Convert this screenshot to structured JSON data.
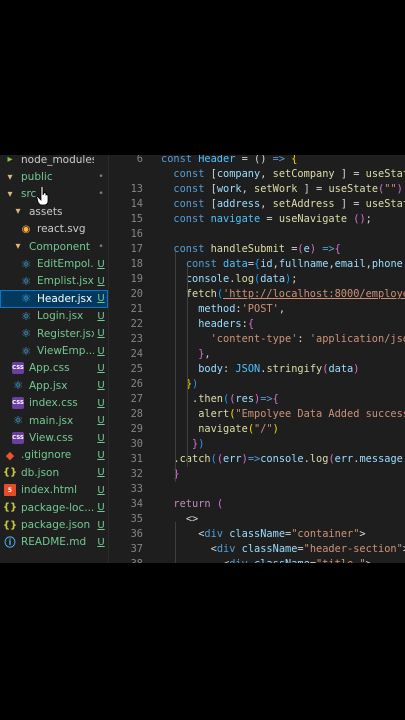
{
  "explorer": {
    "items": [
      {
        "label": "node_modules",
        "icon": "node-folder-icon",
        "status": "",
        "indent": 0
      },
      {
        "label": "public",
        "icon": "folder-icon",
        "status": "•",
        "indent": 0,
        "green": true
      },
      {
        "label": "src",
        "icon": "folder-icon",
        "status": "•",
        "indent": 0,
        "green": true
      },
      {
        "label": "assets",
        "icon": "folder-icon",
        "status": "",
        "indent": 1
      },
      {
        "label": "react.svg",
        "icon": "svg-icon",
        "status": "",
        "indent": 2
      },
      {
        "label": "Component",
        "icon": "folder-icon",
        "status": "•",
        "indent": 1,
        "green": true
      },
      {
        "label": "EditEmpol...",
        "icon": "react-icon",
        "status": "U",
        "indent": 2,
        "green": true
      },
      {
        "label": "Emplist.jsx",
        "icon": "react-icon",
        "status": "U",
        "indent": 2,
        "green": true
      },
      {
        "label": "Header.jsx",
        "icon": "react-icon",
        "status": "U",
        "indent": 2,
        "green": true,
        "selected": true
      },
      {
        "label": "Login.jsx",
        "icon": "react-icon",
        "status": "U",
        "indent": 2,
        "green": true
      },
      {
        "label": "Register.jsx",
        "icon": "react-icon",
        "status": "U",
        "indent": 2,
        "green": true
      },
      {
        "label": "ViewEmp...",
        "icon": "react-icon",
        "status": "U",
        "indent": 2,
        "green": true
      },
      {
        "label": "App.css",
        "icon": "css-icon",
        "status": "U",
        "indent": 1,
        "green": true
      },
      {
        "label": "App.jsx",
        "icon": "react-icon",
        "status": "U",
        "indent": 1,
        "green": true
      },
      {
        "label": "index.css",
        "icon": "css-icon",
        "status": "U",
        "indent": 1,
        "green": true
      },
      {
        "label": "main.jsx",
        "icon": "react-icon",
        "status": "U",
        "indent": 1,
        "green": true
      },
      {
        "label": "View.css",
        "icon": "css-icon",
        "status": "U",
        "indent": 1,
        "green": true
      },
      {
        "label": ".gitignore",
        "icon": "git-icon",
        "status": "U",
        "indent": 0,
        "green": true
      },
      {
        "label": "db.json",
        "icon": "json-icon",
        "status": "U",
        "indent": 0,
        "green": true
      },
      {
        "label": "index.html",
        "icon": "html-icon",
        "status": "U",
        "indent": 0,
        "green": true
      },
      {
        "label": "package-loc...",
        "icon": "json-icon",
        "status": "U",
        "indent": 0,
        "green": true
      },
      {
        "label": "package.json",
        "icon": "json-icon",
        "status": "U",
        "indent": 0,
        "green": true
      },
      {
        "label": "README.md",
        "icon": "info-icon",
        "status": "U",
        "indent": 0,
        "green": true
      }
    ]
  },
  "editor": {
    "lines": [
      {
        "num": "6",
        "tokens": [
          [
            "k",
            "const "
          ],
          [
            "c",
            "Header"
          ],
          [
            "p",
            " = () "
          ],
          [
            "k",
            "=>"
          ],
          [
            "p",
            " "
          ],
          [
            "b1",
            "{"
          ]
        ]
      },
      {
        "num": "",
        "tokens": [
          [
            "p",
            "  "
          ],
          [
            "k",
            "const "
          ],
          [
            "p",
            "["
          ],
          [
            "v",
            "company"
          ],
          [
            "p",
            ", "
          ],
          [
            "f",
            "setCompany"
          ],
          [
            "p",
            " ] = "
          ],
          [
            "f",
            "useState"
          ]
        ]
      },
      {
        "num": "13",
        "tokens": [
          [
            "p",
            "  "
          ],
          [
            "k",
            "const "
          ],
          [
            "p",
            "["
          ],
          [
            "v",
            "work"
          ],
          [
            "p",
            ", "
          ],
          [
            "f",
            "setWork"
          ],
          [
            "p",
            " ] = "
          ],
          [
            "f",
            "useState"
          ],
          [
            "b2",
            "("
          ],
          [
            "s",
            "\"\""
          ],
          [
            "b2",
            ")"
          ]
        ]
      },
      {
        "num": "14",
        "tokens": [
          [
            "p",
            "  "
          ],
          [
            "k",
            "const "
          ],
          [
            "p",
            "["
          ],
          [
            "v",
            "address"
          ],
          [
            "p",
            ", "
          ],
          [
            "f",
            "setAddress"
          ],
          [
            "p",
            " ] = "
          ],
          [
            "f",
            "useState"
          ],
          [
            "b2",
            "("
          ]
        ]
      },
      {
        "num": "15",
        "tokens": [
          [
            "p",
            "  "
          ],
          [
            "k",
            "const "
          ],
          [
            "c",
            "navigate"
          ],
          [
            "p",
            " = "
          ],
          [
            "f",
            "useNavigate"
          ],
          [
            "p",
            " "
          ],
          [
            "b2",
            "("
          ],
          [
            "b2",
            ")"
          ],
          [
            "p",
            ";"
          ]
        ]
      },
      {
        "num": "16",
        "tokens": []
      },
      {
        "num": "17",
        "tokens": [
          [
            "p",
            "  "
          ],
          [
            "k",
            "const "
          ],
          [
            "f",
            "handleSubmit"
          ],
          [
            "p",
            " ="
          ],
          [
            "b2",
            "("
          ],
          [
            "v",
            "e"
          ],
          [
            "b2",
            ")"
          ],
          [
            "p",
            " "
          ],
          [
            "k",
            "=>"
          ],
          [
            "b2",
            "{"
          ]
        ]
      },
      {
        "num": "18",
        "tokens": [
          [
            "p",
            "    "
          ],
          [
            "k",
            "const "
          ],
          [
            "c",
            "data"
          ],
          [
            "p",
            "="
          ],
          [
            "b3",
            "{"
          ],
          [
            "v",
            "id"
          ],
          [
            "p",
            ","
          ],
          [
            "v",
            "fullname"
          ],
          [
            "p",
            ","
          ],
          [
            "v",
            "email"
          ],
          [
            "p",
            ","
          ],
          [
            "v",
            "phone"
          ],
          [
            "p",
            ","
          ]
        ]
      },
      {
        "num": "19",
        "tokens": [
          [
            "p",
            "    "
          ],
          [
            "v",
            "console"
          ],
          [
            "p",
            "."
          ],
          [
            "f",
            "log"
          ],
          [
            "b3",
            "("
          ],
          [
            "v",
            "data"
          ],
          [
            "b3",
            ")"
          ],
          [
            "p",
            ";"
          ]
        ]
      },
      {
        "num": "20",
        "tokens": [
          [
            "p",
            "    "
          ],
          [
            "f",
            "fetch"
          ],
          [
            "b3",
            "("
          ],
          [
            "s u",
            "'http://localhost:8000/employe"
          ]
        ]
      },
      {
        "num": "21",
        "tokens": [
          [
            "p",
            "      "
          ],
          [
            "a",
            "method"
          ],
          [
            "p",
            ":"
          ],
          [
            "s",
            "'POST'"
          ],
          [
            "p",
            ","
          ]
        ]
      },
      {
        "num": "22",
        "tokens": [
          [
            "p",
            "      "
          ],
          [
            "a",
            "headers"
          ],
          [
            "p",
            ":"
          ],
          [
            "b2",
            "{"
          ]
        ]
      },
      {
        "num": "23",
        "tokens": [
          [
            "p",
            "        "
          ],
          [
            "s",
            "'content-type'"
          ],
          [
            "p",
            ": "
          ],
          [
            "s",
            "'application/jso"
          ]
        ]
      },
      {
        "num": "24",
        "tokens": [
          [
            "p",
            "      "
          ],
          [
            "b2",
            "}"
          ],
          [
            "p",
            ","
          ]
        ]
      },
      {
        "num": "25",
        "tokens": [
          [
            "p",
            "      "
          ],
          [
            "a",
            "body"
          ],
          [
            "p",
            ": "
          ],
          [
            "c",
            "JSON"
          ],
          [
            "p",
            "."
          ],
          [
            "f",
            "stringify"
          ],
          [
            "b2",
            "("
          ],
          [
            "v",
            "data"
          ],
          [
            "b2",
            ")"
          ]
        ]
      },
      {
        "num": "26",
        "tokens": [
          [
            "p",
            "    "
          ],
          [
            "b1",
            "}"
          ],
          [
            "b3",
            ")"
          ]
        ]
      },
      {
        "num": "27",
        "tokens": [
          [
            "p",
            "     ."
          ],
          [
            "f",
            "then"
          ],
          [
            "b3",
            "("
          ],
          [
            "b2",
            "("
          ],
          [
            "v",
            "res"
          ],
          [
            "b2",
            ")"
          ],
          [
            "k",
            "=>"
          ],
          [
            "b2",
            "{"
          ]
        ]
      },
      {
        "num": "28",
        "tokens": [
          [
            "p",
            "      "
          ],
          [
            "f",
            "alert"
          ],
          [
            "b1",
            "("
          ],
          [
            "s",
            "\"Empolyee Data Added success"
          ]
        ]
      },
      {
        "num": "29",
        "tokens": [
          [
            "p",
            "      "
          ],
          [
            "f",
            "navigate"
          ],
          [
            "b1",
            "("
          ],
          [
            "s",
            "\"/\""
          ],
          [
            "b1",
            ")"
          ]
        ]
      },
      {
        "num": "30",
        "tokens": [
          [
            "p",
            "     "
          ],
          [
            "b2",
            "}"
          ],
          [
            "b3",
            ")"
          ]
        ]
      },
      {
        "num": "31",
        "tokens": [
          [
            "p",
            "  ."
          ],
          [
            "f",
            "catch"
          ],
          [
            "b3",
            "("
          ],
          [
            "b2",
            "("
          ],
          [
            "v",
            "err"
          ],
          [
            "b2",
            ")"
          ],
          [
            "k",
            "=>"
          ],
          [
            "v",
            "console"
          ],
          [
            "p",
            "."
          ],
          [
            "f",
            "log"
          ],
          [
            "b2",
            "("
          ],
          [
            "v",
            "err"
          ],
          [
            "p",
            "."
          ],
          [
            "v",
            "message"
          ]
        ]
      },
      {
        "num": "32",
        "tokens": [
          [
            "p",
            "  "
          ],
          [
            "b2",
            "}"
          ]
        ]
      },
      {
        "num": "33",
        "tokens": []
      },
      {
        "num": "34",
        "tokens": [
          [
            "p",
            "  "
          ],
          [
            "kw",
            "return"
          ],
          [
            "p",
            " "
          ],
          [
            "b2",
            "("
          ]
        ]
      },
      {
        "num": "35",
        "tokens": [
          [
            "p",
            "    "
          ],
          [
            "p",
            "<>"
          ]
        ]
      },
      {
        "num": "36",
        "tokens": [
          [
            "p",
            "      "
          ],
          [
            "p",
            "<"
          ],
          [
            "t",
            "div"
          ],
          [
            "p",
            " "
          ],
          [
            "a",
            "className"
          ],
          [
            "p",
            "="
          ],
          [
            "s",
            "\"container\""
          ],
          [
            "p",
            ">"
          ]
        ]
      },
      {
        "num": "37",
        "tokens": [
          [
            "p",
            "        "
          ],
          [
            "p",
            "<"
          ],
          [
            "t",
            "div"
          ],
          [
            "p",
            " "
          ],
          [
            "a",
            "className"
          ],
          [
            "p",
            "="
          ],
          [
            "s",
            "\"header-section\""
          ],
          [
            "p",
            ">"
          ]
        ]
      },
      {
        "num": "38",
        "tokens": [
          [
            "p",
            "          "
          ],
          [
            "p",
            "<"
          ],
          [
            "t",
            "div"
          ],
          [
            "p",
            " "
          ],
          [
            "a",
            "className"
          ],
          [
            "p",
            "="
          ],
          [
            "s",
            "\"title \""
          ],
          [
            "p",
            ">"
          ]
        ]
      }
    ]
  }
}
